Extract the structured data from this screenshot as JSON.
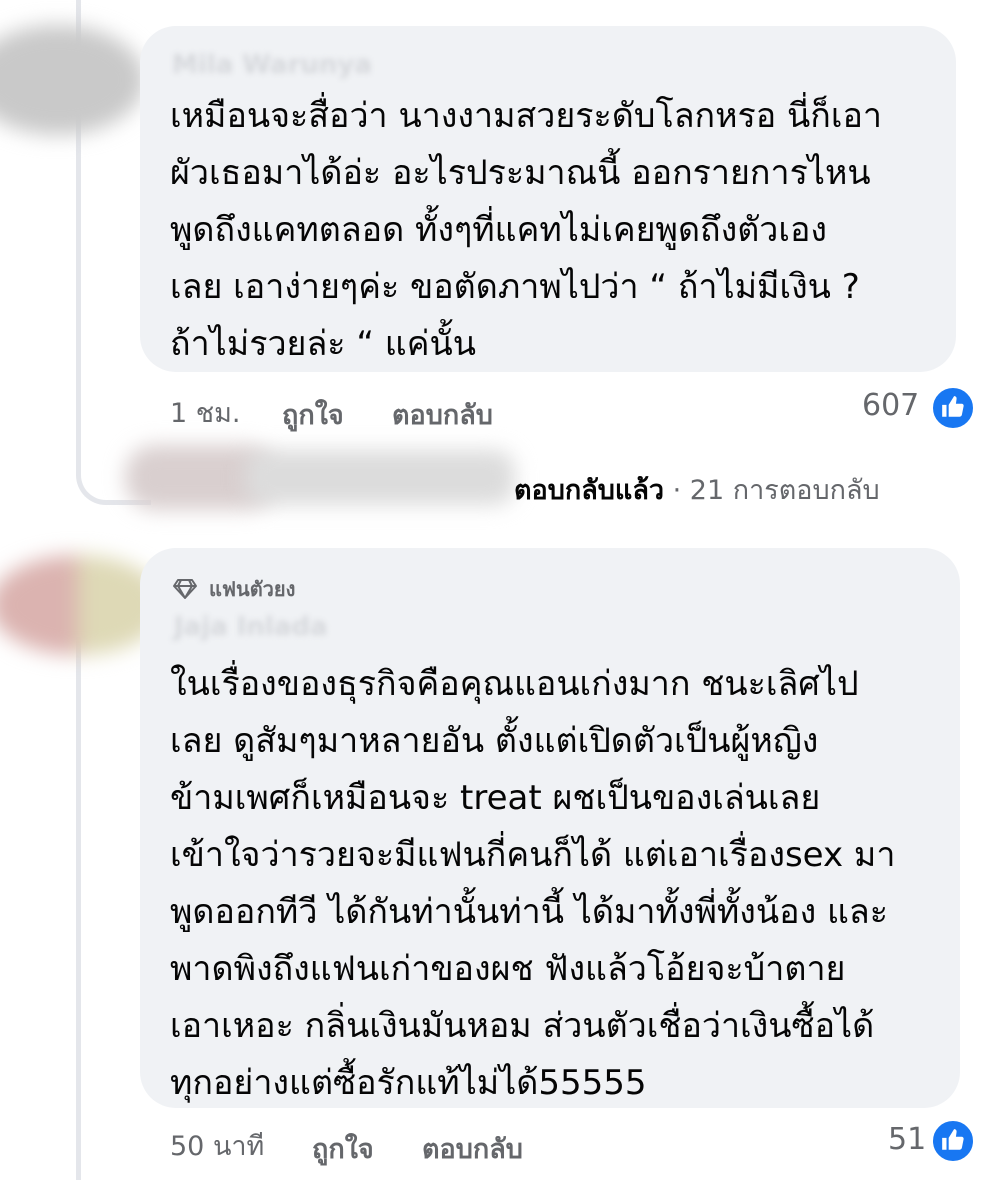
{
  "comments": [
    {
      "author": "Mila Warunya",
      "text": "เหมือนจะสื่อว่า นางงามสวยระดับโลกหรอ นี่ก็เอา\nผัวเธอมาได้อ่ะ อะไรประมาณนี้ ออกรายการไหน\nพูดถึงแคทตลอด ทั้งๆที่แคทไม่เคยพูดถึงตัวเอง\nเลย เอาง่ายๆค่ะ ขอตัดภาพไปว่า “ ถ้าไม่มีเงิน ?\nถ้าไม่รวยล่ะ “ แค่นั้น",
      "time": "1 ชม.",
      "like_label": "ถูกใจ",
      "reply_label": "ตอบกลับ",
      "reaction_count": "607",
      "replied_text": "ตอบกลับแล้ว",
      "replies_count_text": "· 21 การตอบกลับ"
    },
    {
      "badge": "แฟนตัวยง",
      "author": "Jaja Inlada",
      "text": "ในเรื่องของธุรกิจคือคุณแอนเก่งมาก ชนะเลิศไป\nเลย ดูสัมๆมาหลายอัน ตั้งแต่เปิดตัวเป็นผู้หญิง\nข้ามเพศก็เหมือนจะ treat ผชเป็นของเล่นเลย\nเข้าใจว่ารวยจะมีแฟนกี่คนก็ได้ แต่เอาเรื่องsex มา\nพูดออกทีวี ได้กันท่านั้นท่านี้ ได้มาทั้งพี่ทั้งน้อง และ\nพาดพิงถึงแฟนเก่าของผช ฟังแล้วโอ้ยจะบ้าตาย\nเอาเหอะ กลิ่นเงินมันหอม ส่วนตัวเชื่อว่าเงินซื้อได้\nทุกอย่างแต่ซื้อรักแท้ไม่ได้55555",
      "time": "50 นาที",
      "like_label": "ถูกใจ",
      "reply_label": "ตอบกลับ",
      "reaction_count": "51"
    }
  ],
  "icons": {
    "reaction": "like-thumb-icon",
    "badge": "diamond-icon"
  },
  "colors": {
    "bubble": "#f0f2f5",
    "like_blue": "#1877f2",
    "meta_gray": "#65676b"
  }
}
